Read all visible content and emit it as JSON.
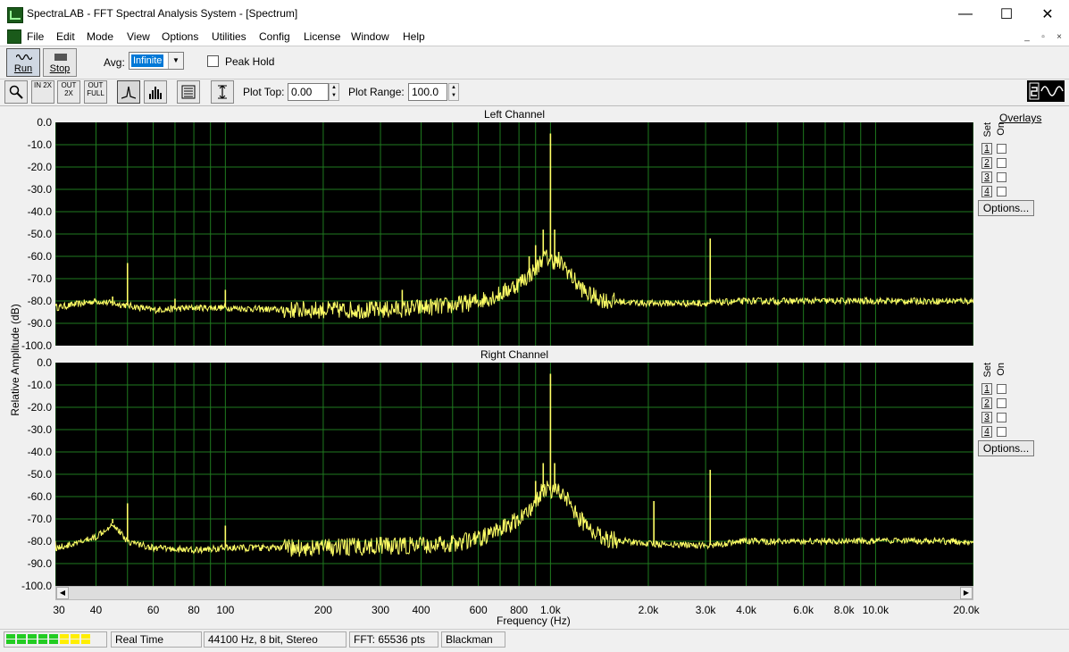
{
  "window": {
    "title": "SpectraLAB - FFT Spectral Analysis System - [Spectrum]",
    "min_glyph": "—",
    "max_glyph": "☐",
    "close_glyph": "✕"
  },
  "menu": {
    "items": [
      "File",
      "Edit",
      "Mode",
      "View",
      "Options",
      "Utilities",
      "Config",
      "License",
      "Window",
      "Help"
    ],
    "mdi_min": "_",
    "mdi_restore": "▫",
    "mdi_close": "×"
  },
  "toolbar1": {
    "run_label": "Run",
    "stop_label": "Stop",
    "avg_label": "Avg:",
    "avg_value": "Infinite",
    "peak_hold_label": "Peak Hold",
    "peak_hold_checked": false
  },
  "toolbar2": {
    "buttons": [
      {
        "name": "zoom-icon",
        "text": ""
      },
      {
        "name": "zoom-in-2x-icon",
        "text": "IN 2X"
      },
      {
        "name": "zoom-out-2x-icon",
        "text": "OUT 2X"
      },
      {
        "name": "zoom-out-full-icon",
        "text": "OUT FULL"
      },
      {
        "name": "line-graph-icon",
        "text": ""
      },
      {
        "name": "bar-graph-icon",
        "text": ""
      },
      {
        "name": "settings-panel-icon",
        "text": ""
      },
      {
        "name": "autoscale-icon",
        "text": ""
      }
    ],
    "plot_top_label": "Plot Top:",
    "plot_top_value": "0.00",
    "plot_range_label": "Plot Range:",
    "plot_range_value": "100.0"
  },
  "plots": {
    "ylabel": "Relative Amplitude (dB)",
    "xlabel": "Frequency (Hz)",
    "ytick_labels": [
      "0.0",
      "-10.0",
      "-20.0",
      "-30.0",
      "-40.0",
      "-50.0",
      "-60.0",
      "-70.0",
      "-80.0",
      "-90.0",
      "-100.0"
    ],
    "xtick_labels": [
      "30",
      "40",
      "60",
      "80",
      "100",
      "200",
      "300",
      "400",
      "600",
      "800",
      "1.0k",
      "2.0k",
      "3.0k",
      "4.0k",
      "6.0k",
      "8.0k",
      "10.0k",
      "20.0k"
    ],
    "left_title": "Left Channel",
    "right_title": "Right Channel",
    "colors": {
      "background": "#000000",
      "grid": "#1f7a1f",
      "trace": "#ffff66"
    }
  },
  "chart_data": [
    {
      "type": "line",
      "title": "Left Channel",
      "xlabel": "Frequency (Hz)",
      "ylabel": "Relative Amplitude (dB)",
      "x_scale": "log",
      "xlim": [
        30,
        20000
      ],
      "ylim": [
        -100,
        0
      ],
      "grid": true,
      "baseline": [
        [
          30,
          -83
        ],
        [
          40,
          -80
        ],
        [
          50,
          -82
        ],
        [
          60,
          -84
        ],
        [
          80,
          -83
        ],
        [
          100,
          -83
        ],
        [
          150,
          -84
        ],
        [
          200,
          -84
        ],
        [
          300,
          -84
        ],
        [
          400,
          -83
        ],
        [
          500,
          -82
        ],
        [
          600,
          -80
        ],
        [
          700,
          -77
        ],
        [
          800,
          -72
        ],
        [
          900,
          -66
        ],
        [
          950,
          -60
        ],
        [
          1100,
          -64
        ],
        [
          1200,
          -72
        ],
        [
          1300,
          -77
        ],
        [
          1500,
          -80
        ],
        [
          2000,
          -81
        ],
        [
          3000,
          -81
        ],
        [
          4000,
          -80
        ],
        [
          6000,
          -80
        ],
        [
          10000,
          -80
        ],
        [
          20000,
          -80
        ]
      ],
      "peaks": [
        [
          45,
          -78
        ],
        [
          50,
          -63
        ],
        [
          70,
          -79
        ],
        [
          100,
          -75
        ],
        [
          350,
          -75
        ],
        [
          860,
          -60
        ],
        [
          900,
          -55
        ],
        [
          950,
          -48
        ],
        [
          1000,
          -5
        ],
        [
          1030,
          -48
        ],
        [
          1060,
          -58
        ],
        [
          3100,
          -52
        ]
      ]
    },
    {
      "type": "line",
      "title": "Right Channel",
      "xlabel": "Frequency (Hz)",
      "ylabel": "Relative Amplitude (dB)",
      "x_scale": "log",
      "xlim": [
        30,
        20000
      ],
      "ylim": [
        -100,
        0
      ],
      "grid": true,
      "baseline": [
        [
          30,
          -83
        ],
        [
          35,
          -81
        ],
        [
          40,
          -78
        ],
        [
          45,
          -72
        ],
        [
          50,
          -80
        ],
        [
          60,
          -83
        ],
        [
          80,
          -84
        ],
        [
          100,
          -83
        ],
        [
          150,
          -83
        ],
        [
          200,
          -83
        ],
        [
          300,
          -82
        ],
        [
          400,
          -82
        ],
        [
          500,
          -81
        ],
        [
          600,
          -79
        ],
        [
          700,
          -75
        ],
        [
          800,
          -70
        ],
        [
          900,
          -63
        ],
        [
          950,
          -56
        ],
        [
          1100,
          -58
        ],
        [
          1200,
          -68
        ],
        [
          1300,
          -74
        ],
        [
          1500,
          -79
        ],
        [
          2000,
          -81
        ],
        [
          3000,
          -82
        ],
        [
          4000,
          -80
        ],
        [
          6000,
          -80
        ],
        [
          10000,
          -80
        ],
        [
          20000,
          -80
        ]
      ],
      "peaks": [
        [
          45,
          -70
        ],
        [
          50,
          -63
        ],
        [
          100,
          -73
        ],
        [
          900,
          -53
        ],
        [
          950,
          -45
        ],
        [
          1000,
          -5
        ],
        [
          1030,
          -45
        ],
        [
          1060,
          -55
        ],
        [
          2080,
          -62
        ],
        [
          3100,
          -48
        ]
      ]
    }
  ],
  "overlays": {
    "title": "Overlays",
    "set_label": "Set",
    "on_label": "On",
    "items": [
      "1",
      "2",
      "3",
      "4"
    ],
    "options_label": "Options..."
  },
  "status": {
    "mode": "Real Time",
    "format": "44100 Hz, 8 bit, Stereo",
    "fft": "FFT: 65536 pts",
    "window": "Blackman",
    "level_colors": [
      "#22cc22",
      "#22cc22",
      "#22cc22",
      "#22cc22",
      "#22cc22",
      "#ffee00",
      "#ffee00",
      "#ffee00"
    ]
  }
}
